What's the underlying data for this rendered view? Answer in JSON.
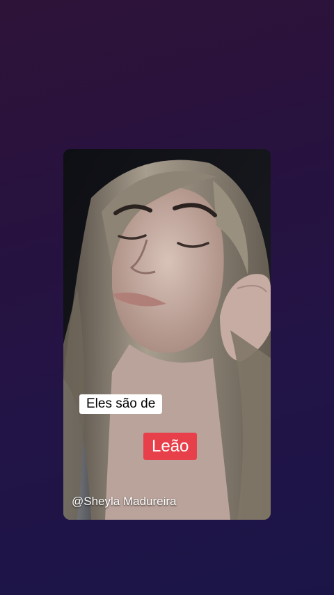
{
  "video": {
    "caption_line_1": "Eles são de",
    "caption_line_2": "Leão",
    "username": "@Sheyla Madureira"
  },
  "colors": {
    "background_top": "#2e1338",
    "background_bottom": "#1b1547",
    "caption_1_bg": "#ffffff",
    "caption_2_bg": "#e8404a"
  }
}
